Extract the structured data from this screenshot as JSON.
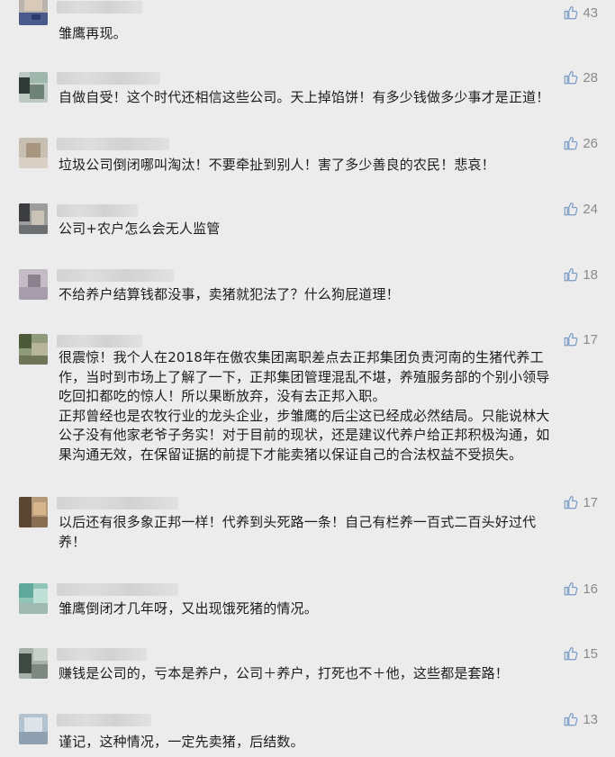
{
  "comments": [
    {
      "likes": "43",
      "text": "雏鹰再现。"
    },
    {
      "likes": "28",
      "text": "自做自受！这个时代还相信这些公司。天上掉馅饼！有多少钱做多少事才是正道！"
    },
    {
      "likes": "26",
      "text": "垃圾公司倒闭哪叫淘汰！不要牵扯到别人！害了多少善良的农民！悲哀！"
    },
    {
      "likes": "24",
      "text": "公司+农户怎么会无人监管"
    },
    {
      "likes": "18",
      "text": "不给养户结算钱都没事，卖猪就犯法了？什么狗屁道理！"
    },
    {
      "likes": "17",
      "text": "很震惊！我个人在2018年在傲农集团离职差点去正邦集团负责河南的生猪代养工\n作，当时到市场上了解了一下，正邦集团管理混乱不堪，养殖服务部的个别小领导\n吃回扣都吃的惊人！所以果断放弃，没有去正邦入职。\n正邦曾经也是农牧行业的龙头企业，步雏鹰的后尘这已经成必然结局。只能说林大\n公子没有他家老爷子务实！对于目前的现状，还是建议代养户给正邦积极沟通，如\n果沟通无效，在保留证据的前提下才能卖猪以保证自己的合法权益不受损失。"
    },
    {
      "likes": "17",
      "text": "以后还有很多象正邦一样！代养到头死路一条！自己有栏养一百式二百头好过代\n养！"
    },
    {
      "likes": "16",
      "text": "雏鹰倒闭才几年呀，又出现饿死猪的情况。"
    },
    {
      "likes": "15",
      "text": "赚钱是公司的，亏本是养户，公司＋养户，打死也不＋他，这些都是套路！"
    },
    {
      "likes": "13",
      "text": "谨记，这种情况，一定先卖猪，后结数。"
    }
  ],
  "icons": {
    "like": "thumbs-up-icon"
  },
  "colors": {
    "background": "#ececec",
    "text": "#1d1d1d",
    "like_text": "#8a8a8a"
  }
}
